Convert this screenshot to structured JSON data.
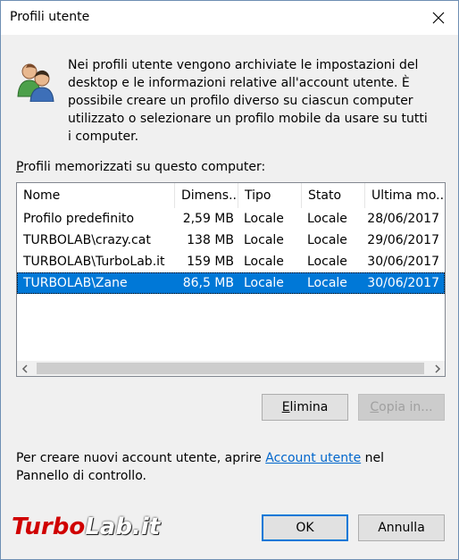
{
  "window": {
    "title": "Profili utente"
  },
  "description": "Nei profili utente vengono archiviate le impostazioni del desktop e le informazioni relative all'account utente. È possibile creare un profilo diverso su ciascun computer utilizzato o selezionare un profilo mobile da usare su tutti i computer.",
  "list_label": {
    "mnemonic": "P",
    "rest": "rofili memorizzati su questo computer:"
  },
  "columns": [
    "Nome",
    "Dimens...",
    "Tipo",
    "Stato",
    "Ultima mo..."
  ],
  "rows": [
    {
      "name": "Profilo predefinito",
      "size": "2,59 MB",
      "type": "Locale",
      "status": "Locale",
      "modified": "28/06/2017",
      "selected": false
    },
    {
      "name": "TURBOLAB\\crazy.cat",
      "size": "138 MB",
      "type": "Locale",
      "status": "Locale",
      "modified": "29/06/2017",
      "selected": false
    },
    {
      "name": "TURBOLAB\\TurboLab.it",
      "size": "159 MB",
      "type": "Locale",
      "status": "Locale",
      "modified": "30/06/2017",
      "selected": false
    },
    {
      "name": "TURBOLAB\\Zane",
      "size": "86,5 MB",
      "type": "Locale",
      "status": "Locale",
      "modified": "30/06/2017",
      "selected": true
    }
  ],
  "buttons": {
    "delete": {
      "mnemonic": "E",
      "rest": "limina"
    },
    "copy": {
      "mnemonic": "C",
      "rest": "opia in..."
    },
    "ok": "OK",
    "cancel": "Annulla"
  },
  "info": {
    "before": "Per creare nuovi account utente, aprire ",
    "link": "Account utente",
    "after": " nel Pannello di controllo."
  },
  "watermark": {
    "part1": "Turbo",
    "part2": "Lab.it"
  },
  "colors": {
    "selection": "#0078d7",
    "link": "#0066cc",
    "default_button_border": "#0078d7"
  }
}
